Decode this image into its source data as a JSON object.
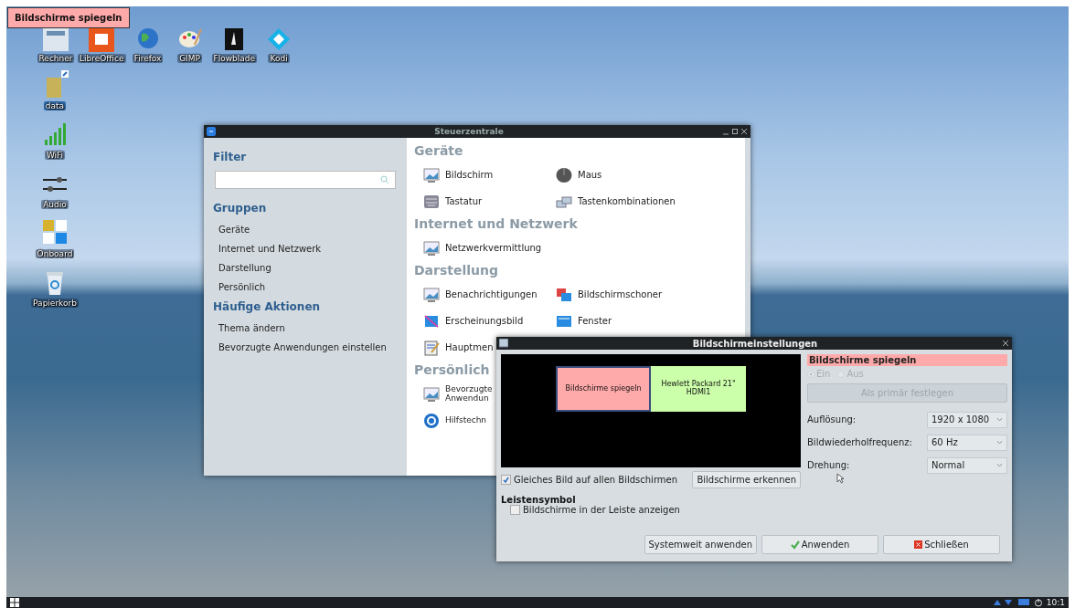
{
  "tooltip": {
    "text": "Bildschirme spiegeln"
  },
  "top_icons": [
    {
      "label": "Rechner"
    },
    {
      "label": "LibreOffice"
    },
    {
      "label": "Firefox"
    },
    {
      "label": "GIMP"
    },
    {
      "label": "Flowblade"
    },
    {
      "label": "Kodi"
    }
  ],
  "side_icons": [
    {
      "label": "data",
      "selected": true
    },
    {
      "label": "WiFi",
      "selected": false
    },
    {
      "label": "Audio",
      "selected": false
    },
    {
      "label": "Onboard",
      "selected": false
    },
    {
      "label": "Papierkorb",
      "selected": false
    }
  ],
  "control_center": {
    "title": "Steuerzentrale",
    "sidebar": {
      "filter_heading": "Filter",
      "groups_heading": "Gruppen",
      "groups": [
        "Geräte",
        "Internet und Netzwerk",
        "Darstellung",
        "Persönlich"
      ],
      "actions_heading": "Häufige Aktionen",
      "actions": [
        "Thema ändern",
        "Bevorzugte Anwendungen einstellen"
      ]
    },
    "sections": [
      {
        "title": "Geräte",
        "items": [
          "Bildschirm",
          "Maus",
          "Tastatur",
          "Tastenkombinationen"
        ]
      },
      {
        "title": "Internet und Netzwerk",
        "items": [
          "Netzwerkvermittlung"
        ]
      },
      {
        "title": "Darstellung",
        "items": [
          "Benachrichtigungen",
          "Bildschirmschoner",
          "Erscheinungsbild",
          "Fenster",
          "Hauptmen"
        ]
      },
      {
        "title": "Persönlich",
        "items": [
          "Bevorzugte Anwendun",
          "Hilfstechn"
        ]
      }
    ]
  },
  "display_dialog": {
    "title": "Bildschirmeinstellungen",
    "monitors": [
      {
        "lines": [
          "Bildschirme spiegeln"
        ],
        "color": "#ffaaaa",
        "selected": true
      },
      {
        "lines": [
          "Hewlett Packard 21\"",
          "HDMI1"
        ],
        "color": "#ccffaa",
        "selected": false
      }
    ],
    "selected_heading": "Bildschirme spiegeln",
    "radios": [
      {
        "label": "Ein",
        "selected": true
      },
      {
        "label": "Aus",
        "selected": false
      }
    ],
    "radios_disabled": true,
    "primary_button": {
      "label": "Als primär festlegen",
      "disabled": true
    },
    "settings": [
      {
        "label": "Auflösung:",
        "value": "1920 x 1080"
      },
      {
        "label": "Bildwiederholfrequenz:",
        "value": "60 Hz"
      },
      {
        "label": "Drehung:",
        "value": "Normal"
      }
    ],
    "mirror_checkbox": {
      "label": "Gleiches Bild auf allen Bildschirmen",
      "checked": true
    },
    "detect_button": "Bildschirme erkennen",
    "tray_heading": "Leistensymbol",
    "tray_checkbox": {
      "label": "Bildschirme in der Leiste anzeigen",
      "checked": false
    },
    "buttons": [
      {
        "label": "Systemweit anwenden",
        "kind": "plain"
      },
      {
        "label": "Anwenden",
        "kind": "apply"
      },
      {
        "label": "Schließen",
        "kind": "close"
      }
    ]
  },
  "taskbar": {
    "clock": "10:1"
  }
}
